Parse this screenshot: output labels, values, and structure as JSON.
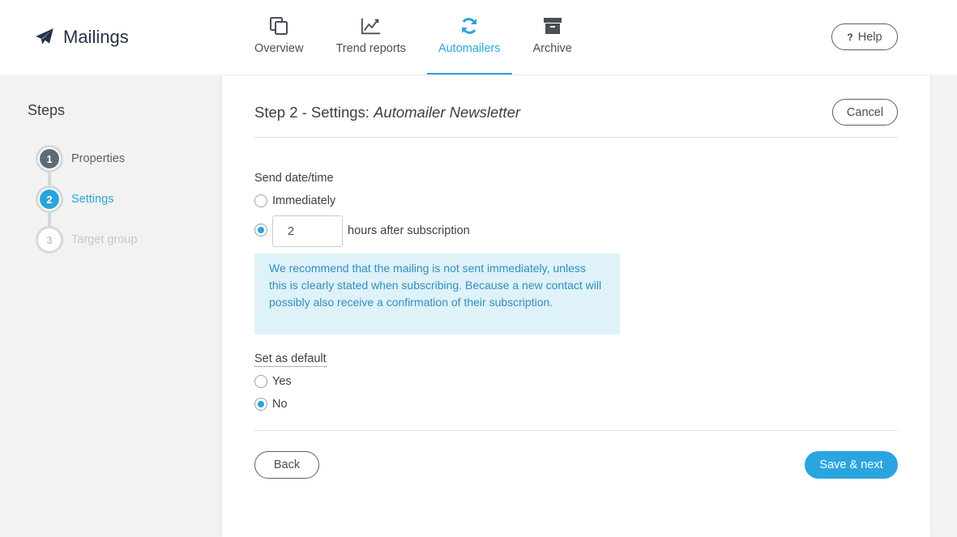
{
  "app": {
    "title": "Mailings",
    "brand_icon": "paper-plane-icon"
  },
  "nav": {
    "items": [
      {
        "label": "Overview",
        "icon": "copy-icon",
        "active": false
      },
      {
        "label": "Trend reports",
        "icon": "line-chart-icon",
        "active": false
      },
      {
        "label": "Automailers",
        "icon": "refresh-icon",
        "active": true
      },
      {
        "label": "Archive",
        "icon": "archive-icon",
        "active": false
      }
    ]
  },
  "help": {
    "label": "Help",
    "icon_text": "?"
  },
  "steps": {
    "title": "Steps",
    "items": [
      {
        "number": "1",
        "label": "Properties",
        "state": "done"
      },
      {
        "number": "2",
        "label": "Settings",
        "state": "current"
      },
      {
        "number": "3",
        "label": "Target group",
        "state": "future"
      }
    ]
  },
  "card": {
    "title_prefix": "Step 2 - Settings: ",
    "title_name": "Automailer Newsletter",
    "cancel_label": "Cancel",
    "send": {
      "label": "Send date/time",
      "option_immediately": "Immediately",
      "hours_value": "2",
      "hours_suffix": "hours after subscription",
      "selected": "hours"
    },
    "info": "We recommend that the mailing is not sent immediately, unless this is clearly stated when subscribing. Because a new contact will possibly also receive a confirmation of their subscription.",
    "default": {
      "label": "Set as default",
      "option_yes": "Yes",
      "option_no": "No",
      "selected": "No"
    },
    "back_label": "Back",
    "save_label": "Save & next"
  },
  "colors": {
    "accent": "#2aa5d9",
    "brand_dark": "#243247",
    "info_bg": "#dff1f9",
    "info_text": "#2f8fbd"
  }
}
